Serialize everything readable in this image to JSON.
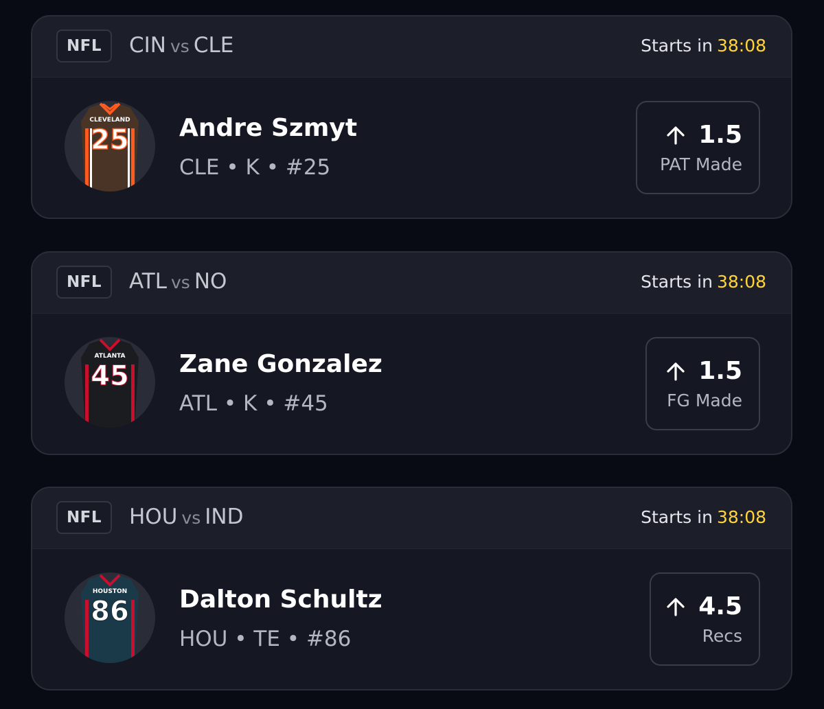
{
  "cards": [
    {
      "league": "NFL",
      "away_team": "CIN",
      "vs": "vs",
      "home_team": "CLE",
      "starts_label": "Starts in",
      "timer": "38:08",
      "player": {
        "name": "Andre Szmyt",
        "team": "CLE",
        "position": "K",
        "number": "#25",
        "jersey_text": "CLEVELAND",
        "jersey_number": "25",
        "jersey_color": "#4a3425",
        "jersey_accent": "#ff5a1f"
      },
      "prop": {
        "direction_icon": "arrow-up-icon",
        "line": "1.5",
        "stat": "PAT Made"
      }
    },
    {
      "league": "NFL",
      "away_team": "ATL",
      "vs": "vs",
      "home_team": "NO",
      "starts_label": "Starts in",
      "timer": "38:08",
      "player": {
        "name": "Zane Gonzalez",
        "team": "ATL",
        "position": "K",
        "number": "#45",
        "jersey_text": "ATLANTA",
        "jersey_number": "45",
        "jersey_color": "#1b1c20",
        "jersey_accent": "#c8102e"
      },
      "prop": {
        "direction_icon": "arrow-up-icon",
        "line": "1.5",
        "stat": "FG Made"
      }
    },
    {
      "league": "NFL",
      "away_team": "HOU",
      "vs": "vs",
      "home_team": "IND",
      "starts_label": "Starts in",
      "timer": "38:08",
      "player": {
        "name": "Dalton Schultz",
        "team": "HOU",
        "position": "TE",
        "number": "#86",
        "jersey_text": "HOUSTON",
        "jersey_number": "86",
        "jersey_color": "#1a3a4a",
        "jersey_accent": "#c8102e"
      },
      "prop": {
        "direction_icon": "arrow-up-icon",
        "line": "4.5",
        "stat": "Recs"
      }
    }
  ],
  "colors": {
    "background": "#090b14",
    "timer": "#ffd43b",
    "card": "#151722",
    "card_header": "#1c1f2a"
  }
}
